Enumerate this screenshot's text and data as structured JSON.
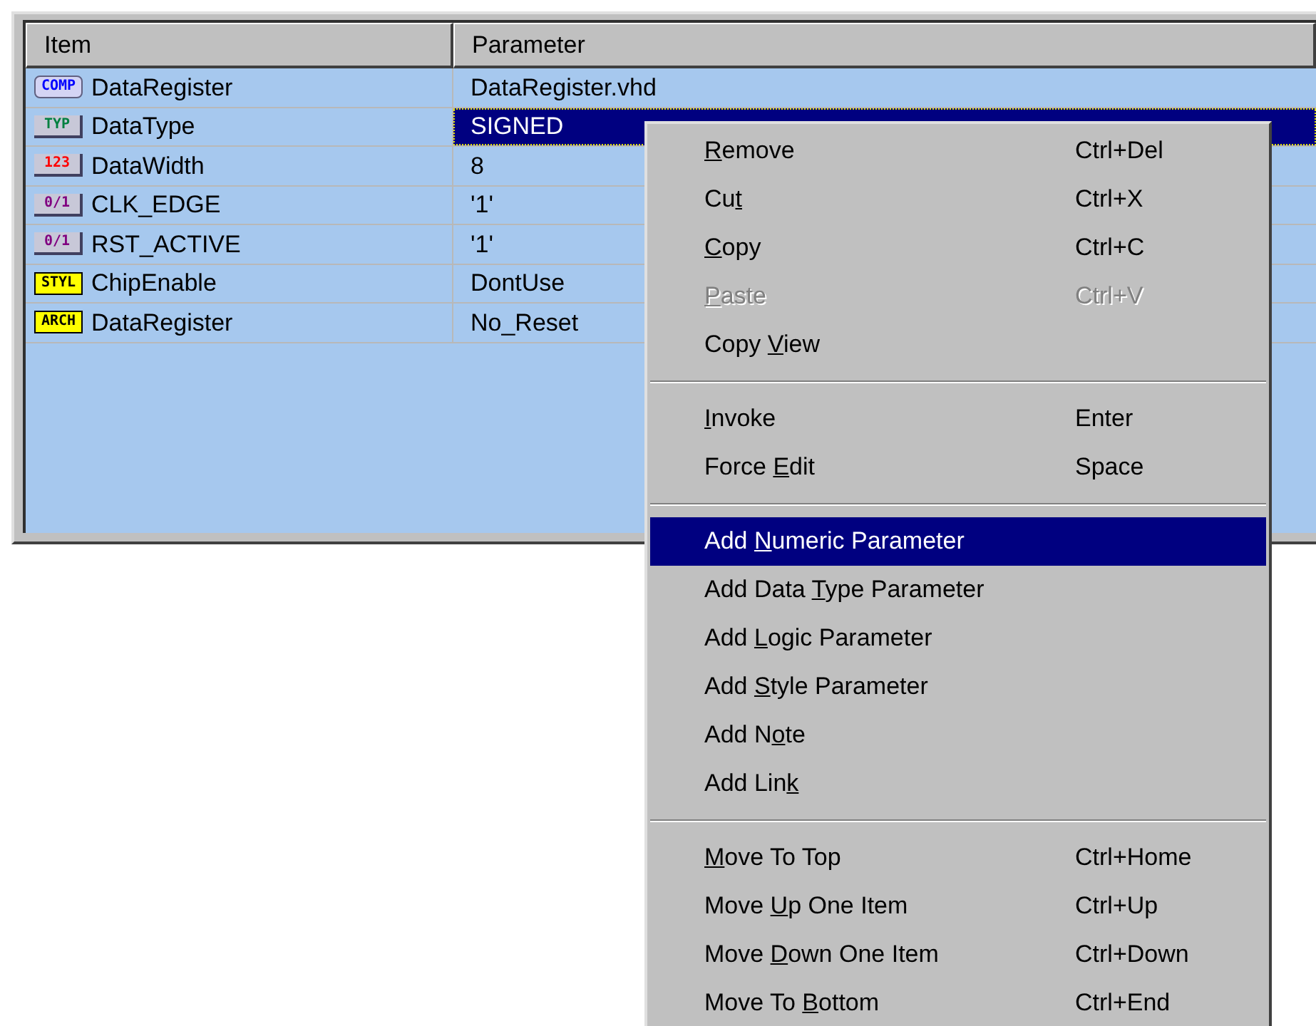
{
  "table": {
    "columns": [
      "Item",
      "Parameter"
    ],
    "rows": [
      {
        "badge": "COMP",
        "kind": "comp",
        "color": "#0000ff",
        "item": "DataRegister",
        "parameter": "DataRegister.vhd",
        "selected": false
      },
      {
        "badge": "TYP",
        "kind": "box",
        "color": "#008040",
        "item": "DataType",
        "parameter": "SIGNED",
        "selected": true
      },
      {
        "badge": "123",
        "kind": "box",
        "color": "#ff0000",
        "item": "DataWidth",
        "parameter": "8",
        "selected": false
      },
      {
        "badge": "0/1",
        "kind": "box",
        "color": "#800080",
        "item": "CLK_EDGE",
        "parameter": "'1'",
        "selected": false
      },
      {
        "badge": "0/1",
        "kind": "box",
        "color": "#800080",
        "item": "RST_ACTIVE",
        "parameter": "'1'",
        "selected": false
      },
      {
        "badge": "STYL",
        "kind": "yellow",
        "color": "#000000",
        "item": "ChipEnable",
        "parameter": "DontUse",
        "selected": false
      },
      {
        "badge": "ARCH",
        "kind": "yellow",
        "color": "#000000",
        "item": "DataRegister",
        "parameter": "No_Reset",
        "selected": false
      }
    ]
  },
  "context_menu": {
    "groups": [
      [
        {
          "key": "R",
          "after": "emove",
          "shortcut": "Ctrl+Del",
          "disabled": false,
          "selected": false
        },
        {
          "before": "Cu",
          "key": "t",
          "shortcut": "Ctrl+X",
          "disabled": false,
          "selected": false
        },
        {
          "key": "C",
          "after": "opy",
          "shortcut": "Ctrl+C",
          "disabled": false,
          "selected": false
        },
        {
          "key": "P",
          "after": "aste",
          "shortcut": "Ctrl+V",
          "disabled": true,
          "selected": false
        },
        {
          "before": "Copy ",
          "key": "V",
          "after": "iew",
          "disabled": false,
          "selected": false
        }
      ],
      [
        {
          "key": "I",
          "after": "nvoke",
          "shortcut": "Enter",
          "disabled": false,
          "selected": false
        },
        {
          "before": "Force ",
          "key": "E",
          "after": "dit",
          "shortcut": "Space",
          "disabled": false,
          "selected": false
        }
      ],
      [
        {
          "before": "Add ",
          "key": "N",
          "after": "umeric Parameter",
          "disabled": false,
          "selected": true
        },
        {
          "before": "Add Data ",
          "key": "T",
          "after": "ype Parameter",
          "disabled": false,
          "selected": false
        },
        {
          "before": "Add ",
          "key": "L",
          "after": "ogic Parameter",
          "disabled": false,
          "selected": false
        },
        {
          "before": "Add ",
          "key": "S",
          "after": "tyle Parameter",
          "disabled": false,
          "selected": false
        },
        {
          "before": "Add N",
          "key": "o",
          "after": "te",
          "disabled": false,
          "selected": false
        },
        {
          "before": "Add Lin",
          "key": "k",
          "disabled": false,
          "selected": false
        }
      ],
      [
        {
          "key": "M",
          "after": "ove To Top",
          "shortcut": "Ctrl+Home",
          "disabled": false,
          "selected": false
        },
        {
          "before": "Move ",
          "key": "U",
          "after": "p One Item",
          "shortcut": "Ctrl+Up",
          "disabled": false,
          "selected": false
        },
        {
          "before": "Move ",
          "key": "D",
          "after": "own One Item",
          "shortcut": "Ctrl+Down",
          "disabled": false,
          "selected": false
        },
        {
          "before": "Move To ",
          "key": "B",
          "after": "ottom",
          "shortcut": "Ctrl+End",
          "disabled": false,
          "selected": false
        }
      ]
    ]
  }
}
